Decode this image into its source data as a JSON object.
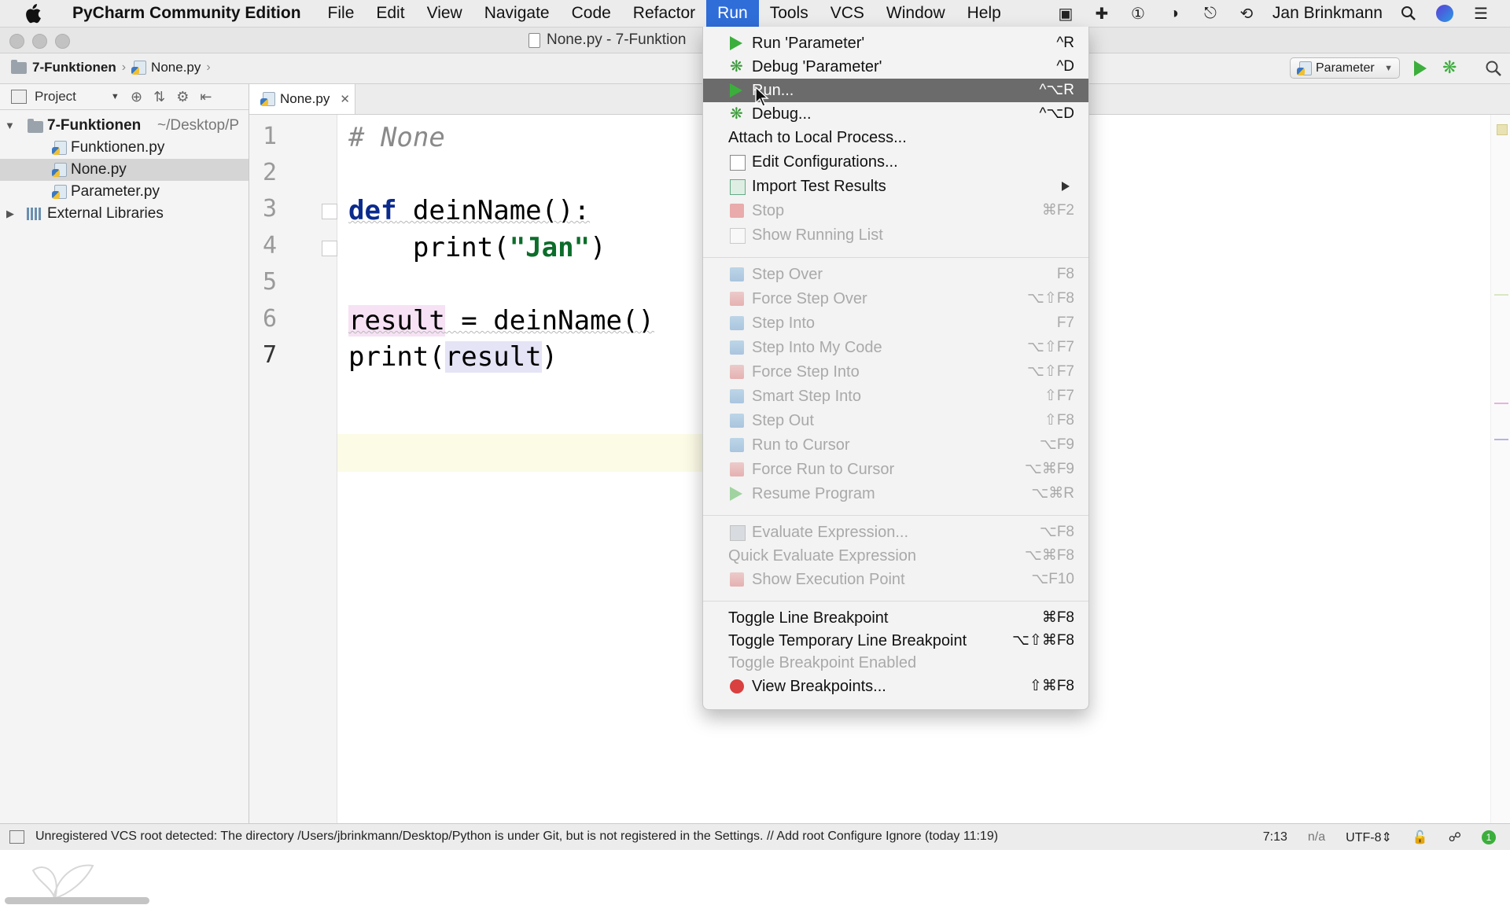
{
  "menubar": {
    "app_name": "PyCharm Community Edition",
    "items": [
      "File",
      "Edit",
      "View",
      "Navigate",
      "Code",
      "Refactor",
      "Run",
      "Tools",
      "VCS",
      "Window",
      "Help"
    ],
    "active_item": "Run",
    "user": "Jan Brinkmann",
    "status_icons": [
      "video-camera-icon",
      "plus-cross-icon",
      "1password-icon",
      "bird-icon",
      "bell-icon",
      "time-machine-icon",
      "spotlight-icon",
      "siri-icon",
      "notification-list-icon"
    ]
  },
  "window": {
    "title": "None.py - 7-Funktion"
  },
  "navbar": {
    "breadcrumbs": [
      "7-Funktionen",
      "None.py"
    ],
    "run_config": "Parameter"
  },
  "project": {
    "header": "Project",
    "root": {
      "name": "7-Funktionen",
      "path": "~/Desktop/P"
    },
    "files": [
      "Funktionen.py",
      "None.py",
      "Parameter.py"
    ],
    "selected_file": "None.py",
    "libraries": "External Libraries"
  },
  "editor": {
    "tab": "None.py",
    "line_numbers": [
      "1",
      "2",
      "3",
      "4",
      "5",
      "6",
      "7"
    ],
    "code": {
      "l1": "# None",
      "l3_kw": "def",
      "l3_rest": " deinName():",
      "l4_a": "    print(",
      "l4_str": "\"Jan\"",
      "l4_b": ")",
      "l6_a": "result",
      "l6_b": " = deinName()",
      "l7_a": "print(",
      "l7_b": "result",
      "l7_c": ")"
    }
  },
  "run_menu": {
    "items": [
      {
        "label": "Run 'Parameter'",
        "shortcut": "^R",
        "icon": "run-icon",
        "enabled": true
      },
      {
        "label": "Debug 'Parameter'",
        "shortcut": "^D",
        "icon": "debug-icon",
        "enabled": true
      },
      {
        "label": "Run...",
        "shortcut": "^⌥R",
        "icon": "run-icon",
        "enabled": true,
        "highlighted": true
      },
      {
        "label": "Debug...",
        "shortcut": "^⌥D",
        "icon": "debug-icon",
        "enabled": true
      },
      {
        "label": "Attach to Local Process...",
        "shortcut": "",
        "icon": "",
        "enabled": true
      },
      {
        "label": "Edit Configurations...",
        "shortcut": "",
        "icon": "edit-config-icon",
        "enabled": true
      },
      {
        "label": "Import Test Results",
        "shortcut": "",
        "icon": "import-icon",
        "enabled": true,
        "submenu": true
      },
      {
        "label": "Stop",
        "shortcut": "⌘F2",
        "icon": "stop-icon",
        "enabled": false
      },
      {
        "label": "Show Running List",
        "shortcut": "",
        "icon": "list-icon",
        "enabled": false
      },
      {
        "label": "Step Over",
        "shortcut": "F8",
        "icon": "step-over-icon",
        "enabled": false
      },
      {
        "label": "Force Step Over",
        "shortcut": "⌥⇧F8",
        "icon": "force-step-over-icon",
        "enabled": false
      },
      {
        "label": "Step Into",
        "shortcut": "F7",
        "icon": "step-into-icon",
        "enabled": false
      },
      {
        "label": "Step Into My Code",
        "shortcut": "⌥⇧F7",
        "icon": "step-into-my-code-icon",
        "enabled": false
      },
      {
        "label": "Force Step Into",
        "shortcut": "⌥⇧F7",
        "icon": "force-step-into-icon",
        "enabled": false
      },
      {
        "label": "Smart Step Into",
        "shortcut": "⇧F7",
        "icon": "smart-step-into-icon",
        "enabled": false
      },
      {
        "label": "Step Out",
        "shortcut": "⇧F8",
        "icon": "step-out-icon",
        "enabled": false
      },
      {
        "label": "Run to Cursor",
        "shortcut": "⌥F9",
        "icon": "run-to-cursor-icon",
        "enabled": false
      },
      {
        "label": "Force Run to Cursor",
        "shortcut": "⌥⌘F9",
        "icon": "force-run-to-cursor-icon",
        "enabled": false
      },
      {
        "label": "Resume Program",
        "shortcut": "⌥⌘R",
        "icon": "resume-icon",
        "enabled": false
      },
      {
        "label": "Evaluate Expression...",
        "shortcut": "⌥F8",
        "icon": "evaluate-icon",
        "enabled": false
      },
      {
        "label": "Quick Evaluate Expression",
        "shortcut": "⌥⌘F8",
        "icon": "",
        "enabled": false
      },
      {
        "label": "Show Execution Point",
        "shortcut": "⌥F10",
        "icon": "execution-point-icon",
        "enabled": false
      },
      {
        "label": "Toggle Line Breakpoint",
        "shortcut": "⌘F8",
        "icon": "",
        "enabled": true
      },
      {
        "label": "Toggle Temporary Line Breakpoint",
        "shortcut": "⌥⇧⌘F8",
        "icon": "",
        "enabled": true
      },
      {
        "label": "Toggle Breakpoint Enabled",
        "shortcut": "",
        "icon": "",
        "enabled": false
      },
      {
        "label": "View Breakpoints...",
        "shortcut": "⇧⌘F8",
        "icon": "breakpoints-icon",
        "enabled": true
      }
    ]
  },
  "statusbar": {
    "message": "Unregistered VCS root detected: The directory /Users/jbrinkmann/Desktop/Python is under Git, but is not registered in the Settings. // Add root  Configure  Ignore (today 11:19)",
    "position": "7:13",
    "na": "n/a",
    "encoding": "UTF-8⇕"
  },
  "colors": {
    "menu_active": "#2f6dd8",
    "menu_highlight": "#6b6b6b",
    "run_green": "#3cae3c",
    "keyword": "#0b2b8c",
    "string": "#0c6d2a"
  }
}
